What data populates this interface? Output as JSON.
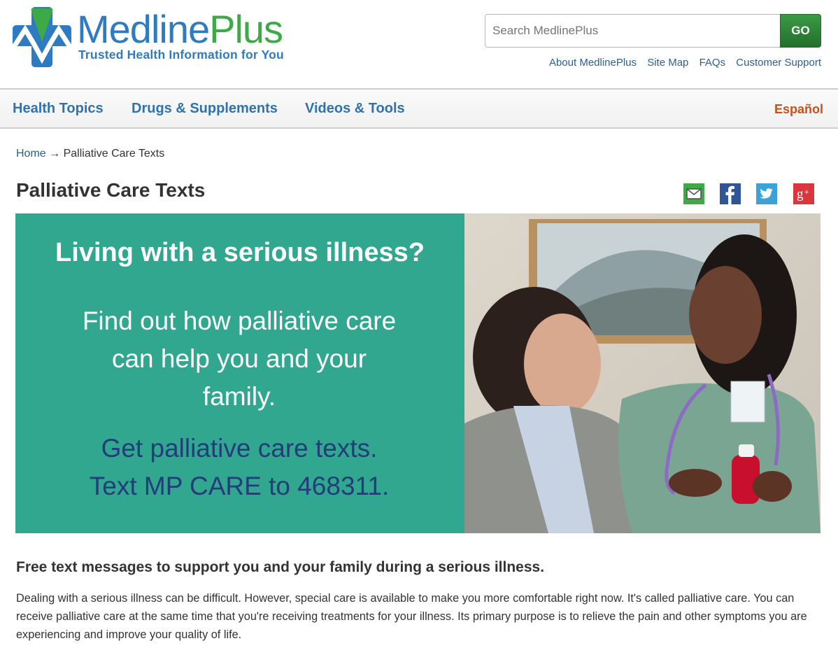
{
  "site": {
    "logo_word_1": "Medline",
    "logo_word_2": "Plus",
    "tagline": "Trusted Health Information for You",
    "colors": {
      "brand_blue": "#2f7bc1",
      "brand_green": "#3eaa47",
      "espanol_orange": "#c4511b",
      "banner_teal": "#31a78f",
      "banner_cta_navy": "#233d7a"
    }
  },
  "search": {
    "placeholder": "Search MedlinePlus",
    "value": "",
    "button_label": "GO"
  },
  "util_links": [
    {
      "label": "About MedlinePlus"
    },
    {
      "label": "Site Map"
    },
    {
      "label": "FAQs"
    },
    {
      "label": "Customer Support"
    }
  ],
  "nav": {
    "items": [
      {
        "label": "Health Topics"
      },
      {
        "label": "Drugs & Supplements"
      },
      {
        "label": "Videos & Tools"
      }
    ],
    "language_link": "Español"
  },
  "breadcrumb": {
    "home": "Home",
    "separator": "→",
    "current": "Palliative Care Texts"
  },
  "page": {
    "title": "Palliative Care Texts"
  },
  "share": [
    {
      "name": "email",
      "icon": "envelope-icon",
      "color": "#3eaa47"
    },
    {
      "name": "facebook",
      "icon": "facebook-icon",
      "color": "#2f5597"
    },
    {
      "name": "twitter",
      "icon": "twitter-icon",
      "color": "#3ba3d8"
    },
    {
      "name": "google-plus",
      "icon": "google-plus-icon",
      "color": "#d9363e"
    }
  ],
  "banner": {
    "headline": "Living with a serious illness?",
    "body": "Find out how palliative care can help you and your family.",
    "cta_line_1": "Get palliative care texts.",
    "cta_line_2": "Text MP CARE to 468311.",
    "photo_alt": "Nurse in scrubs with stethoscope talking with a woman patient"
  },
  "content": {
    "subheading": "Free text messages to support you and your family during a serious illness.",
    "intro": "Dealing with a serious illness can be difficult. However, special care is available to make you more comfortable right now. It's called palliative care. You can receive palliative care at the same time that you're receiving treatments for your illness. Its primary purpose is to relieve the pain and other symptoms you are experiencing and improve your quality of life."
  }
}
